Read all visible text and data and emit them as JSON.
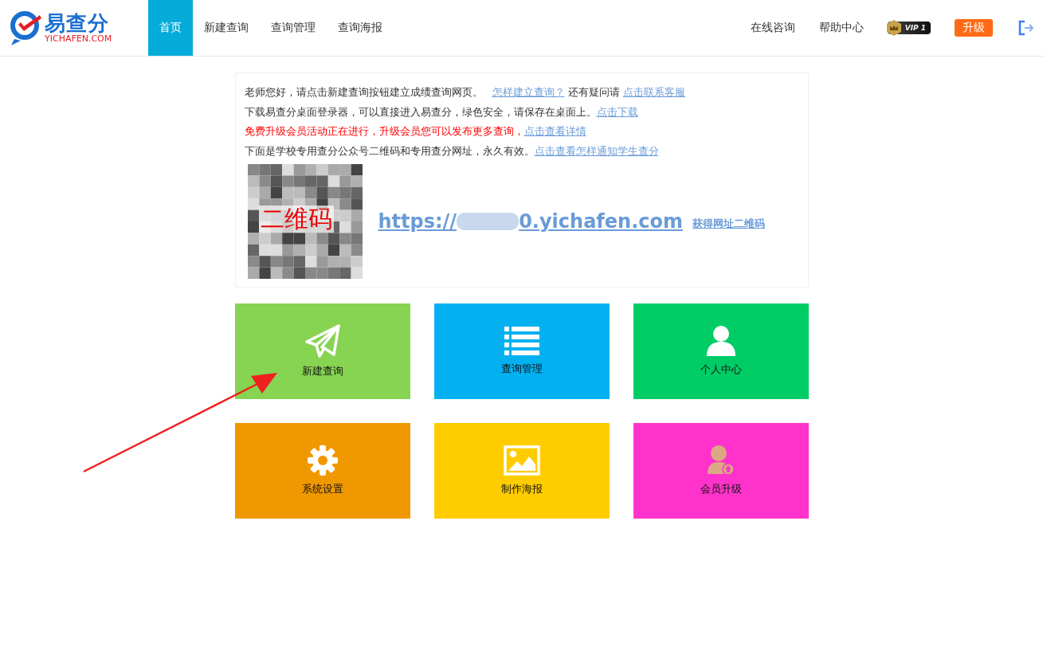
{
  "header": {
    "logo": {
      "name": "易查分",
      "domain": "YICHAFEN.COM"
    },
    "nav": [
      {
        "label": "首页",
        "selected": true
      },
      {
        "label": "新建查询",
        "selected": false
      },
      {
        "label": "查询管理",
        "selected": false
      },
      {
        "label": "查询海报",
        "selected": false
      }
    ],
    "right_links": [
      "在线咨询",
      "帮助中心"
    ],
    "vip_badge": "VIP 1",
    "upgrade_button": "升级"
  },
  "notice": {
    "lines": [
      {
        "kind": "normal",
        "text": "老师您好，请点击新建查询按钮建立成绩查询网页。",
        "links": [
          "怎样建立查询？",
          "点击联系客服"
        ],
        "between": "还有疑问请"
      },
      {
        "kind": "normal",
        "text": "下载易查分桌面登录器，可以直接进入易查分，绿色安全，请保存在桌面上。",
        "links": [
          "点击下载"
        ]
      },
      {
        "kind": "highlight",
        "text": "免费升级会员活动正在进行，升级会员您可以发布更多查询，",
        "links": [
          "点击查看详情"
        ]
      },
      {
        "kind": "normal",
        "text": "下面是学校专用查分公众号二维码和专用查分网址，永久有效。",
        "links": [
          "点击查看怎样通知学生查分"
        ]
      }
    ],
    "qr_label": "二维码",
    "url_prefix": "https://",
    "url_suffix": "0.yichafen.com",
    "qr_link": "获得网址二维码"
  },
  "tiles": [
    {
      "kind": "send",
      "label": "新建查询",
      "color": "#87d352"
    },
    {
      "kind": "list",
      "label": "查询管理",
      "color": "#03b1f1"
    },
    {
      "kind": "user",
      "label": "个人中心",
      "color": "#00cc66"
    },
    {
      "kind": "gear",
      "label": "系统设置",
      "color": "#f09800"
    },
    {
      "kind": "image",
      "label": "制作海报",
      "color": "#ffcc00"
    },
    {
      "kind": "upgrade",
      "label": "会员升级",
      "color": "#ff33cc"
    }
  ]
}
